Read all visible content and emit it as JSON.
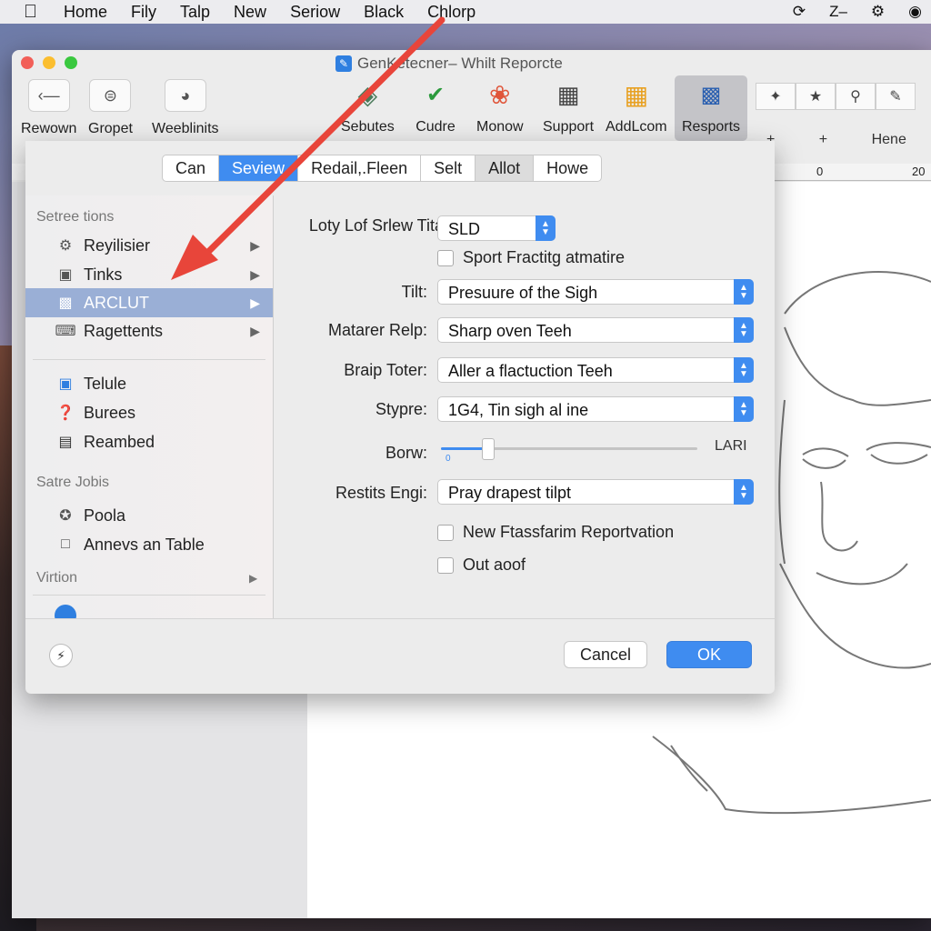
{
  "menubar": {
    "items": [
      "Home",
      "Fily",
      "Talp",
      "New",
      "Seriow",
      "Black",
      "Chlorp"
    ],
    "right_text": "Z–"
  },
  "window": {
    "title": "GenKetecner– Whilt Reporcte"
  },
  "toolbar": {
    "left_items": [
      "Rewown",
      "Gropet",
      "Weeblinits"
    ],
    "center_items": [
      "Sebutes",
      "Cudre",
      "Monow",
      "Support",
      "AddLcom",
      "Resports"
    ],
    "active_item": "Resports",
    "right_label": "Hene"
  },
  "ruler": {
    "marks": [
      "0",
      "20"
    ]
  },
  "sheet": {
    "tabs": [
      "Can",
      "Seview",
      "Redail,.Fleen",
      "Selt",
      "Allot",
      "Howe"
    ],
    "selected_tab": "Seview",
    "sidebar": {
      "section1": "Setree tions",
      "items1": [
        "Reyilisier",
        "Tinks",
        "ARCLUT",
        "Ragettents"
      ],
      "selected_item": "ARCLUT",
      "items2": [
        "Telule",
        "Burees",
        "Reambed"
      ],
      "section2": "Satre Jobis",
      "items3": [
        "Poola",
        "Annevs an Table"
      ],
      "section3": "Virtion"
    },
    "form": {
      "row1_label": "Loty Lof Srlew Titar:",
      "row1_value": "SLD",
      "check1": "Sport Fractitg atmatire",
      "tilt_label": "Tilt:",
      "tilt_value": "Presuure of the Sigh",
      "matarer_label": "Matarer Relp:",
      "matarer_value": "Sharp oven Teeh",
      "braip_label": "Braip Toter:",
      "braip_value": "Aller a flactuction Teeh",
      "stypre_label": "Stypre:",
      "stypre_value": "1G4, Tin sigh al ine",
      "borw_label": "Borw:",
      "borw_value": "LARI",
      "borw_level": 0.18,
      "borw_min": "0",
      "restits_label": "Restits Engi:",
      "restits_value": "Pray drapest tilpt",
      "check2": "New Ftassfarim Reportvation",
      "check3": "Out aoof"
    },
    "buttons": {
      "cancel": "Cancel",
      "ok": "OK"
    }
  },
  "colors": {
    "accent": "#3f8cf0",
    "arrow": "#e8453a",
    "sidebar_selected": "#9aafd6"
  }
}
